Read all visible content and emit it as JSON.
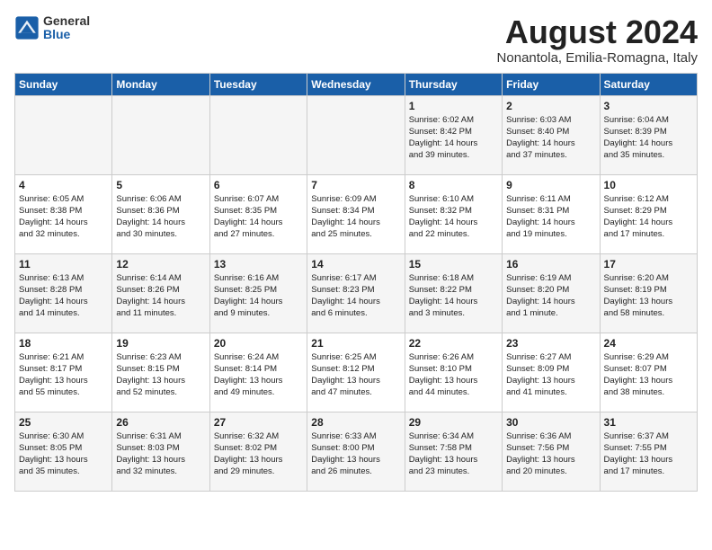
{
  "logo": {
    "general": "General",
    "blue": "Blue"
  },
  "title": "August 2024",
  "location": "Nonantola, Emilia-Romagna, Italy",
  "weekdays": [
    "Sunday",
    "Monday",
    "Tuesday",
    "Wednesday",
    "Thursday",
    "Friday",
    "Saturday"
  ],
  "weeks": [
    [
      {
        "day": "",
        "info": ""
      },
      {
        "day": "",
        "info": ""
      },
      {
        "day": "",
        "info": ""
      },
      {
        "day": "",
        "info": ""
      },
      {
        "day": "1",
        "info": "Sunrise: 6:02 AM\nSunset: 8:42 PM\nDaylight: 14 hours\nand 39 minutes."
      },
      {
        "day": "2",
        "info": "Sunrise: 6:03 AM\nSunset: 8:40 PM\nDaylight: 14 hours\nand 37 minutes."
      },
      {
        "day": "3",
        "info": "Sunrise: 6:04 AM\nSunset: 8:39 PM\nDaylight: 14 hours\nand 35 minutes."
      }
    ],
    [
      {
        "day": "4",
        "info": "Sunrise: 6:05 AM\nSunset: 8:38 PM\nDaylight: 14 hours\nand 32 minutes."
      },
      {
        "day": "5",
        "info": "Sunrise: 6:06 AM\nSunset: 8:36 PM\nDaylight: 14 hours\nand 30 minutes."
      },
      {
        "day": "6",
        "info": "Sunrise: 6:07 AM\nSunset: 8:35 PM\nDaylight: 14 hours\nand 27 minutes."
      },
      {
        "day": "7",
        "info": "Sunrise: 6:09 AM\nSunset: 8:34 PM\nDaylight: 14 hours\nand 25 minutes."
      },
      {
        "day": "8",
        "info": "Sunrise: 6:10 AM\nSunset: 8:32 PM\nDaylight: 14 hours\nand 22 minutes."
      },
      {
        "day": "9",
        "info": "Sunrise: 6:11 AM\nSunset: 8:31 PM\nDaylight: 14 hours\nand 19 minutes."
      },
      {
        "day": "10",
        "info": "Sunrise: 6:12 AM\nSunset: 8:29 PM\nDaylight: 14 hours\nand 17 minutes."
      }
    ],
    [
      {
        "day": "11",
        "info": "Sunrise: 6:13 AM\nSunset: 8:28 PM\nDaylight: 14 hours\nand 14 minutes."
      },
      {
        "day": "12",
        "info": "Sunrise: 6:14 AM\nSunset: 8:26 PM\nDaylight: 14 hours\nand 11 minutes."
      },
      {
        "day": "13",
        "info": "Sunrise: 6:16 AM\nSunset: 8:25 PM\nDaylight: 14 hours\nand 9 minutes."
      },
      {
        "day": "14",
        "info": "Sunrise: 6:17 AM\nSunset: 8:23 PM\nDaylight: 14 hours\nand 6 minutes."
      },
      {
        "day": "15",
        "info": "Sunrise: 6:18 AM\nSunset: 8:22 PM\nDaylight: 14 hours\nand 3 minutes."
      },
      {
        "day": "16",
        "info": "Sunrise: 6:19 AM\nSunset: 8:20 PM\nDaylight: 14 hours\nand 1 minute."
      },
      {
        "day": "17",
        "info": "Sunrise: 6:20 AM\nSunset: 8:19 PM\nDaylight: 13 hours\nand 58 minutes."
      }
    ],
    [
      {
        "day": "18",
        "info": "Sunrise: 6:21 AM\nSunset: 8:17 PM\nDaylight: 13 hours\nand 55 minutes."
      },
      {
        "day": "19",
        "info": "Sunrise: 6:23 AM\nSunset: 8:15 PM\nDaylight: 13 hours\nand 52 minutes."
      },
      {
        "day": "20",
        "info": "Sunrise: 6:24 AM\nSunset: 8:14 PM\nDaylight: 13 hours\nand 49 minutes."
      },
      {
        "day": "21",
        "info": "Sunrise: 6:25 AM\nSunset: 8:12 PM\nDaylight: 13 hours\nand 47 minutes."
      },
      {
        "day": "22",
        "info": "Sunrise: 6:26 AM\nSunset: 8:10 PM\nDaylight: 13 hours\nand 44 minutes."
      },
      {
        "day": "23",
        "info": "Sunrise: 6:27 AM\nSunset: 8:09 PM\nDaylight: 13 hours\nand 41 minutes."
      },
      {
        "day": "24",
        "info": "Sunrise: 6:29 AM\nSunset: 8:07 PM\nDaylight: 13 hours\nand 38 minutes."
      }
    ],
    [
      {
        "day": "25",
        "info": "Sunrise: 6:30 AM\nSunset: 8:05 PM\nDaylight: 13 hours\nand 35 minutes."
      },
      {
        "day": "26",
        "info": "Sunrise: 6:31 AM\nSunset: 8:03 PM\nDaylight: 13 hours\nand 32 minutes."
      },
      {
        "day": "27",
        "info": "Sunrise: 6:32 AM\nSunset: 8:02 PM\nDaylight: 13 hours\nand 29 minutes."
      },
      {
        "day": "28",
        "info": "Sunrise: 6:33 AM\nSunset: 8:00 PM\nDaylight: 13 hours\nand 26 minutes."
      },
      {
        "day": "29",
        "info": "Sunrise: 6:34 AM\nSunset: 7:58 PM\nDaylight: 13 hours\nand 23 minutes."
      },
      {
        "day": "30",
        "info": "Sunrise: 6:36 AM\nSunset: 7:56 PM\nDaylight: 13 hours\nand 20 minutes."
      },
      {
        "day": "31",
        "info": "Sunrise: 6:37 AM\nSunset: 7:55 PM\nDaylight: 13 hours\nand 17 minutes."
      }
    ]
  ]
}
